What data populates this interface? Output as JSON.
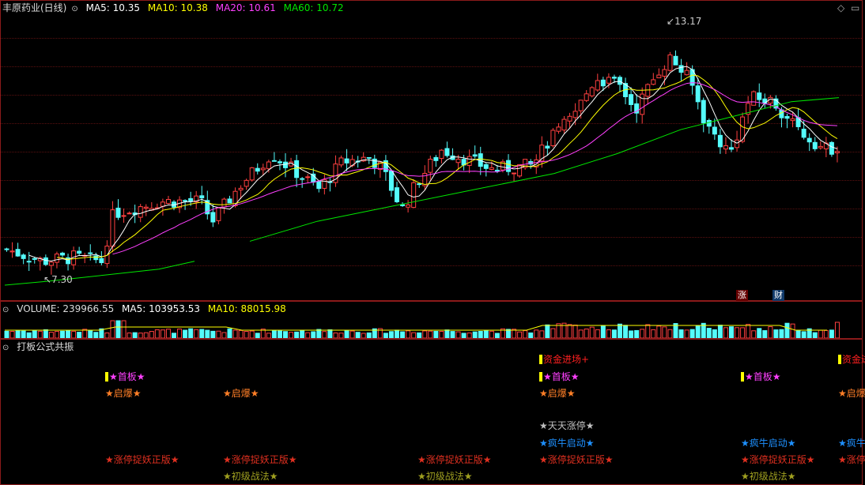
{
  "price_header": {
    "title": "丰原药业(日线)",
    "ma5": "MA5: 10.35",
    "ma10": "MA10: 10.38",
    "ma20": "MA20: 10.61",
    "ma60": "MA60: 10.72",
    "high_label": "13.17",
    "low_label": "7.30",
    "flag_zhang": "涨",
    "flag_cai": "财"
  },
  "volume_header": {
    "volume": "VOLUME: 239966.55",
    "ma5": "MA5: 103953.53",
    "ma10": "MA10: 88015.98"
  },
  "signal_header": {
    "title": "打板公式共振"
  },
  "colors": {
    "up": "#ff4040",
    "down": "#54fcfc",
    "ma5": "#ffffff",
    "ma10": "#ffff00",
    "ma20": "#ff40ff",
    "ma60": "#00e600",
    "grid": "#5a1010"
  },
  "icons": [
    "diamond-icon",
    "window-box-icon"
  ],
  "signals": [
    {
      "text": "资金进场+",
      "color": "#ff2020",
      "mark": "#ffff00"
    },
    {
      "text": "资金进",
      "color": "#ff2020",
      "mark": "#ffff00"
    },
    {
      "text": "★首板★",
      "color": "#ff40ff",
      "mark": "#ffff00"
    },
    {
      "text": "★启爆★",
      "color": "#ff7f27",
      "mark": "#ff7f27"
    },
    {
      "text": "★启爆",
      "color": "#ff7f27",
      "mark": "#ff7f27"
    },
    {
      "text": "★天天涨停★",
      "color": "#c0c0c0",
      "mark": "#c0c0c0"
    },
    {
      "text": "★疯牛启动★",
      "color": "#1e90ff",
      "mark": "#1e90ff"
    },
    {
      "text": "★疯牛",
      "color": "#1e90ff",
      "mark": "#1e90ff"
    },
    {
      "text": "★涨停捉妖正版★",
      "color": "#e03020",
      "mark": "#e03020"
    },
    {
      "text": "★涨停捉妖",
      "color": "#e03020",
      "mark": "#e03020"
    },
    {
      "text": "★初级战法★",
      "color": "#a0a020",
      "mark": "#a0a020"
    }
  ]
}
